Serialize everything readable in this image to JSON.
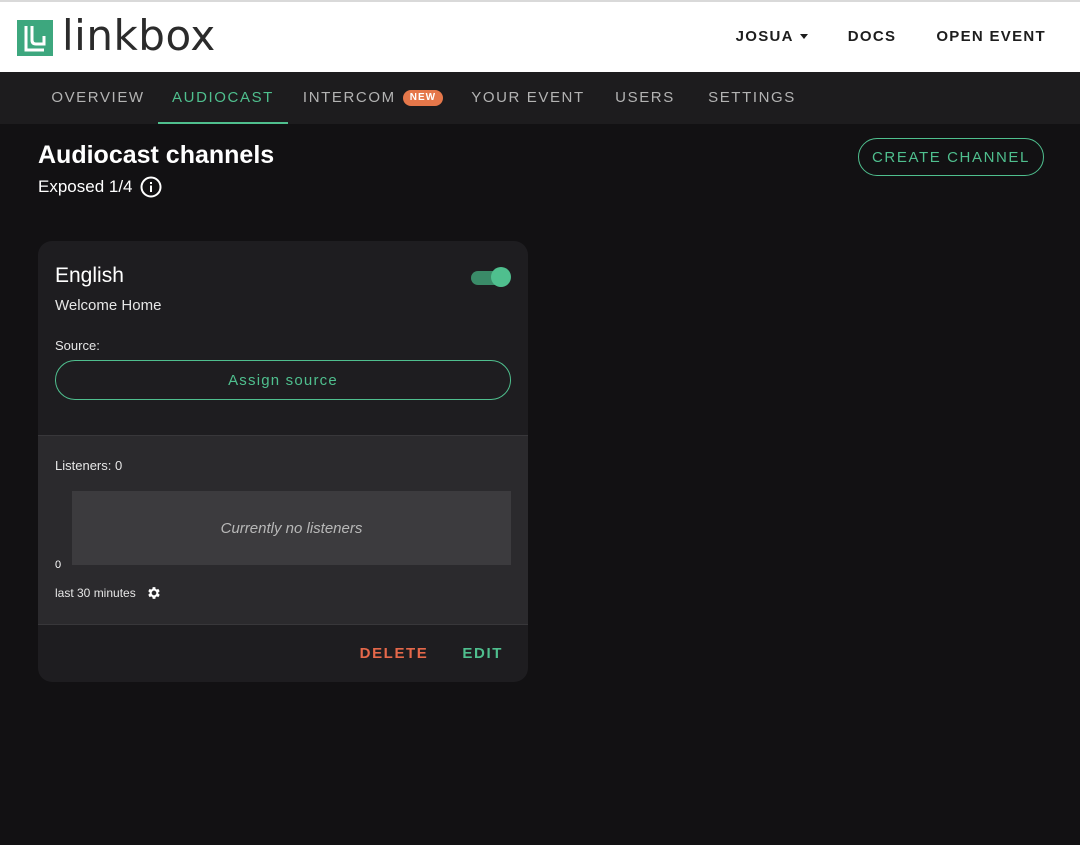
{
  "header": {
    "logo_text": "linkbox",
    "user_menu_label": "JOSUA",
    "docs_label": "DOCS",
    "open_event_label": "OPEN EVENT"
  },
  "tabs": [
    {
      "label": "OVERVIEW",
      "active": false
    },
    {
      "label": "AUDIOCAST",
      "active": true
    },
    {
      "label": "INTERCOM",
      "badge": "NEW",
      "active": false
    },
    {
      "label": "YOUR EVENT",
      "active": false
    },
    {
      "label": "USERS",
      "active": false
    },
    {
      "label": "SETTINGS",
      "active": false
    }
  ],
  "page": {
    "title": "Audiocast channels",
    "exposed": "Exposed 1/4",
    "create_label": "CREATE CHANNEL"
  },
  "channel": {
    "name": "English",
    "subtitle": "Welcome Home",
    "enabled": true,
    "source_label": "Source:",
    "assign_label": "Assign source",
    "listeners_label": "Listeners: 0",
    "empty_text": "Currently no listeners",
    "axis_zero": "0",
    "range_label": "last 30 minutes",
    "delete_label": "DELETE",
    "edit_label": "EDIT"
  },
  "colors": {
    "accent": "#4fbf8e",
    "danger": "#e5684a",
    "badge": "#e5774a",
    "background": "#121113",
    "card": "#1e1d20"
  },
  "icons": {
    "logo": "linkbox-logo-icon",
    "user_menu": "caret-down-icon",
    "info": "info-icon",
    "toggle": "toggle-on",
    "settings": "gear-icon"
  }
}
